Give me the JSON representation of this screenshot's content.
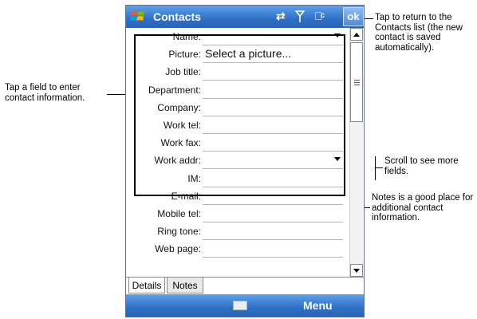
{
  "titlebar": {
    "app_title": "Contacts",
    "ok_label": "ok"
  },
  "form": {
    "fields": [
      {
        "label": "Name:",
        "value": "",
        "dropdown": true
      },
      {
        "label": "Picture:",
        "value": "Select a picture...",
        "dropdown": false
      },
      {
        "label": "Job title:",
        "value": "",
        "dropdown": false
      },
      {
        "label": "Department:",
        "value": "",
        "dropdown": false
      },
      {
        "label": "Company:",
        "value": "",
        "dropdown": false
      },
      {
        "label": "Work tel:",
        "value": "",
        "dropdown": false
      },
      {
        "label": "Work fax:",
        "value": "",
        "dropdown": false
      },
      {
        "label": "Work addr:",
        "value": "",
        "dropdown": true
      },
      {
        "label": "IM:",
        "value": "",
        "dropdown": false
      },
      {
        "label": "E-mail:",
        "value": "",
        "dropdown": false
      },
      {
        "label": "Mobile tel:",
        "value": "",
        "dropdown": false
      },
      {
        "label": "Ring tone:",
        "value": "",
        "dropdown": false
      },
      {
        "label": "Web page:",
        "value": "",
        "dropdown": false
      }
    ]
  },
  "tabs": [
    {
      "label": "Details",
      "active": true
    },
    {
      "label": "Notes",
      "active": false
    }
  ],
  "menubar": {
    "menu_label": "Menu"
  },
  "callouts": {
    "ok_text": "Tap to return to the Contacts list (the new contact is saved automatically).",
    "field_text": "Tap a field to enter contact information.",
    "scroll_text": "Scroll to see more fields.",
    "notes_text": "Notes is a good place for additional contact information."
  },
  "icons": [
    "windows-flag-icon",
    "connectivity-icon",
    "signal-icon",
    "speaker-icon",
    "keyboard-icon"
  ],
  "colors": {
    "titlebar": "#2f6fc6",
    "menubar": "#2f6fc6"
  }
}
